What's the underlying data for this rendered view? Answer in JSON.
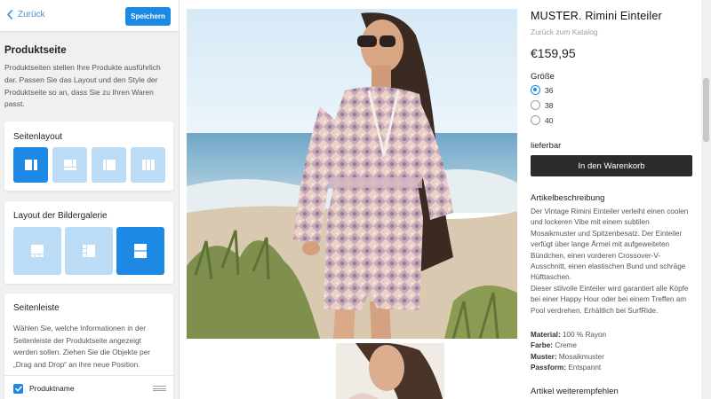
{
  "editor": {
    "back_label": "Zurück",
    "save_label": "Speichern",
    "title": "Produktseite",
    "description": "Produktseiten stellen Ihre Produkte ausführlich dar. Passen Sie das Layout und den Style der Produktseite so an, dass Sie zu Ihren Waren passt.",
    "page_layout": {
      "title": "Seitenlayout",
      "options": [
        "layout-1",
        "layout-2",
        "layout-3",
        "layout-4"
      ],
      "selected_index": 0
    },
    "gallery_layout": {
      "title": "Layout der Bildergalerie",
      "options": [
        "gallery-1",
        "gallery-2",
        "gallery-3"
      ],
      "selected_index": 2
    },
    "sidebar": {
      "title": "Seitenleiste",
      "description": "Wählen Sie, welche Informationen in der Seitenleiste der Produktseite angezeigt werden sollen. Ziehen Sie die Objekte per „Drag and Drop“ an ihre neue Position.",
      "items": [
        {
          "label": "Produktname",
          "checked": true
        }
      ]
    }
  },
  "product": {
    "title": "MUSTER. Rimini Einteiler",
    "catalog_link": "Zurück zum Katalog",
    "price": "€159,95",
    "size_label": "Größe",
    "sizes": [
      "36",
      "38",
      "40"
    ],
    "selected_size_index": 0,
    "availability": "lieferbar",
    "add_to_cart": "In den Warenkorb",
    "description_title": "Artikelbeschreibung",
    "description_p1": "Der Vintage Rimini Einteiler verleiht einen coolen und lockeren Vibe mit einem subtilen Mosaikmuster und Spitzenbesatz. Der Einteiler verfügt über lange Ärmel mit aufgeweiteten Bündchen, einen vorderen Crossover-V-Ausschnitt, einen elastischen Bund und schräge Hüfttaschen.",
    "description_p2": "Dieser stilvolle Einteiler wird garantiert alle Köpfe bei einer Happy Hour oder bei einem Treffen am Pool verdrehen. Erhältlich bei SurfRide.",
    "attributes": [
      {
        "key": "Material:",
        "value": "100 % Rayon"
      },
      {
        "key": "Farbe:",
        "value": "Creme"
      },
      {
        "key": "Muster:",
        "value": "Mosaikmuster"
      },
      {
        "key": "Passform:",
        "value": "Entspannt"
      }
    ],
    "recommend_title": "Artikel weiterempfehlen"
  },
  "colors": {
    "accent": "#1e88e5",
    "accent_light": "#bcdcf6",
    "button_dark": "#2b2b2b",
    "panel_bg": "#eef0f2"
  },
  "scrollbar": {
    "position": 0.22
  }
}
